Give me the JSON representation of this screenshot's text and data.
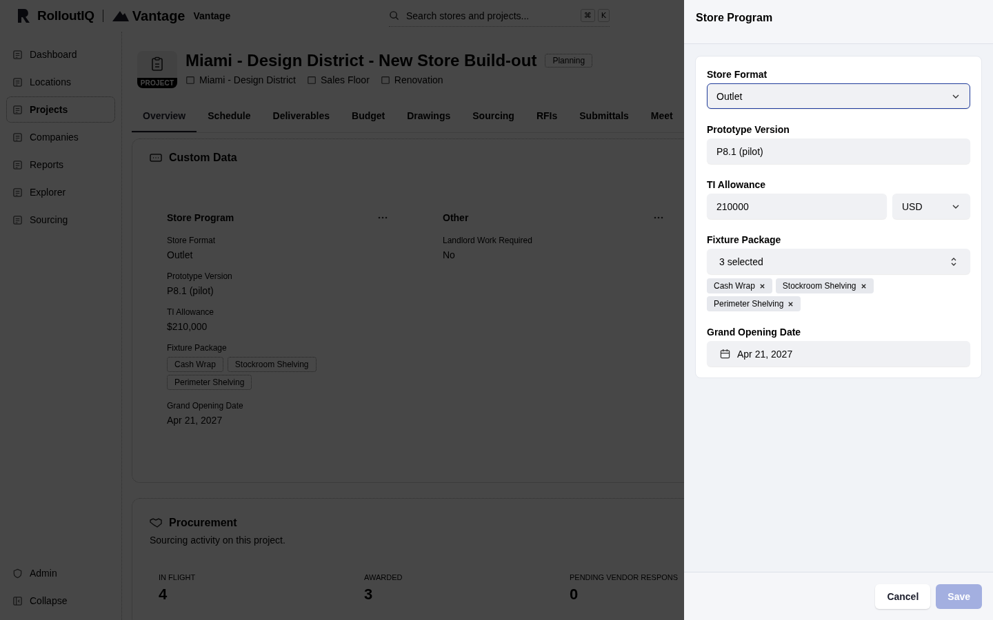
{
  "header": {
    "logo": "RolloutIQ",
    "partner_logo": "Vantage",
    "workspace": "Vantage",
    "search": {
      "placeholder": "Search stores and projects..."
    },
    "shortcut": [
      "⌘",
      "K"
    ]
  },
  "sidebar": {
    "items": [
      {
        "label": "Dashboard",
        "selected": false
      },
      {
        "label": "Locations",
        "selected": false
      },
      {
        "label": "Projects",
        "selected": true
      },
      {
        "label": "Companies",
        "selected": false
      },
      {
        "label": "Reports",
        "selected": false
      },
      {
        "label": "Explorer",
        "selected": false
      },
      {
        "label": "Sourcing",
        "selected": false
      }
    ],
    "bottom_items": [
      "Admin",
      "Collapse"
    ]
  },
  "project": {
    "badge": "PROJECT",
    "title": "Miami - Design District - New Store Build-out",
    "status": "Planning",
    "meta": [
      "Miami - Design District",
      "Sales Floor",
      "Renovation"
    ]
  },
  "tabs": [
    {
      "label": "Overview",
      "selected": true
    },
    {
      "label": "Schedule",
      "selected": false
    },
    {
      "label": "Deliverables",
      "selected": false
    },
    {
      "label": "Budget",
      "selected": false
    },
    {
      "label": "Drawings",
      "selected": false
    },
    {
      "label": "Sourcing",
      "selected": false
    },
    {
      "label": "RFIs",
      "selected": false
    },
    {
      "label": "Submittals",
      "selected": false
    },
    {
      "label": "Meet",
      "selected": false
    }
  ],
  "custom_data": {
    "title": "Custom Data",
    "groups": [
      {
        "title": "Store Program",
        "fields": [
          {
            "label": "Store Format",
            "value": "Outlet"
          },
          {
            "label": "Prototype Version",
            "value": "P8.1 (pilot)"
          },
          {
            "label": "TI Allowance",
            "value": "$210,000"
          },
          {
            "label": "Fixture Package",
            "tags": [
              "Cash Wrap",
              "Stockroom Shelving",
              "Perimeter Shelving"
            ]
          },
          {
            "label": "Grand Opening Date",
            "value": "Apr 21, 2027"
          }
        ]
      },
      {
        "title": "Other",
        "fields": [
          {
            "label": "Landlord Work Required",
            "value": "No"
          }
        ]
      }
    ]
  },
  "procurement": {
    "title": "Procurement",
    "subtitle": "Sourcing activity on this project.",
    "stats": [
      {
        "label": "IN FLIGHT",
        "value": "4"
      },
      {
        "label": "AWARDED",
        "value": "3"
      },
      {
        "label": "PENDING VENDOR RESPONS",
        "value": "0"
      }
    ]
  },
  "drawer": {
    "title": "Store Program",
    "fields": [
      {
        "kind": "select",
        "label": "Store Format",
        "value": "Outlet",
        "focused": true
      },
      {
        "kind": "text",
        "label": "Prototype Version",
        "value": "P8.1 (pilot)"
      },
      {
        "kind": "money",
        "label": "TI Allowance",
        "value": "210000",
        "currency": "USD"
      },
      {
        "kind": "multiselect",
        "label": "Fixture Package",
        "value": "3 selected",
        "tags": [
          "Cash Wrap",
          "Stockroom Shelving",
          "Perimeter Shelving"
        ]
      },
      {
        "kind": "date",
        "label": "Grand Opening Date",
        "value": "Apr 21, 2027"
      }
    ],
    "buttons": [
      {
        "label": "Cancel",
        "kind": "secondary",
        "disabled": false
      },
      {
        "label": "Save",
        "kind": "primary",
        "disabled": true
      }
    ]
  }
}
